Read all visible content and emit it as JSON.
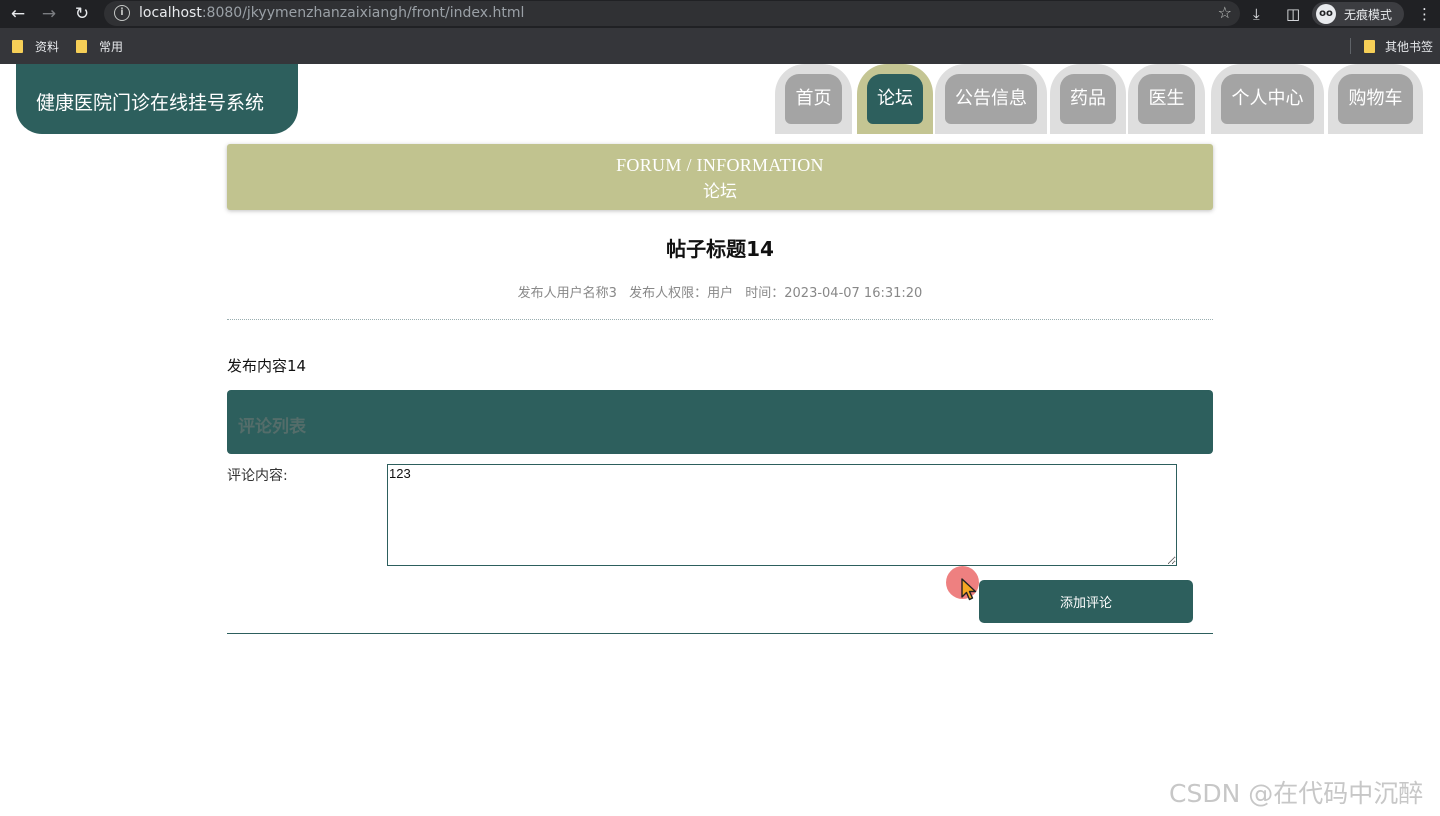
{
  "browser": {
    "url_host": "localhost",
    "url_path": ":8080/jkyymenzhanzaixiangh/front/index.html",
    "incognito_label": "无痕模式",
    "bookmarks": [
      "资料",
      "常用"
    ],
    "other_bookmarks": "其他书签"
  },
  "site": {
    "title": "健康医院门诊在线挂号系统"
  },
  "nav": {
    "items": [
      "首页",
      "论坛",
      "公告信息",
      "药品",
      "医生",
      "个人中心",
      "购物车"
    ],
    "active_index": 1
  },
  "banner": {
    "title_en": "FORUM / INFORMATION",
    "title_cn": "论坛"
  },
  "post": {
    "title": "帖子标题14",
    "author": "发布人用户名称3",
    "role": "发布人权限：用户",
    "time": "时间：2023-04-07 16:31:20",
    "content": "发布内容14"
  },
  "comments": {
    "title": "评论列表",
    "label": "评论内容:",
    "value": "123",
    "button": "添加评论"
  },
  "watermark": "CSDN @在代码中沉醉",
  "colors": {
    "primary": "#2d5f5d",
    "accent": "#c1c38f",
    "tab_bg": "#dedede",
    "tab_pill": "#a4a4a4"
  }
}
